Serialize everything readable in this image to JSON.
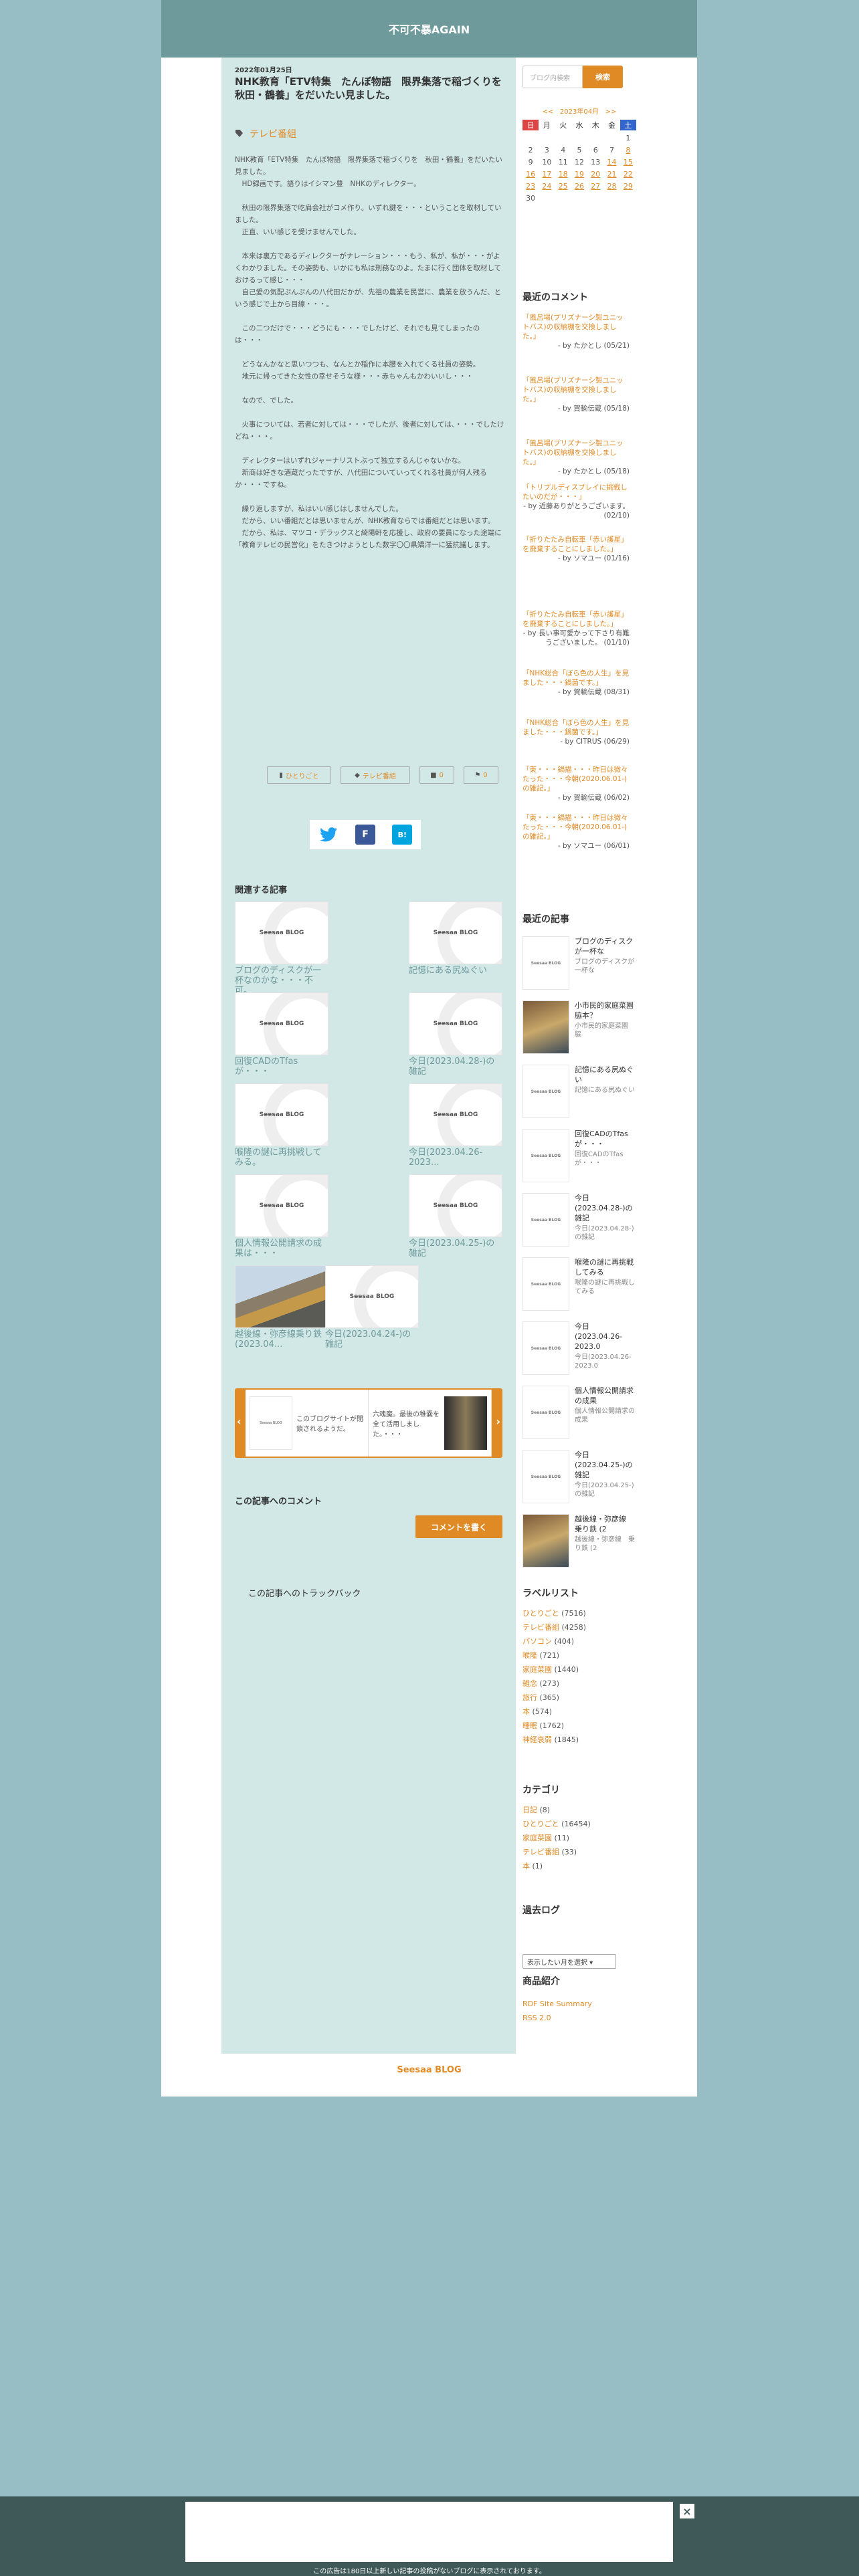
{
  "site": {
    "title": "不可不暴AGAIN",
    "footer": "Seesaa BLOG"
  },
  "post": {
    "date": "2022年01月25日",
    "title": "NHK教育「ETV特集　たんぼ物語　限界集落で稲づくりを　秋田・鶴養」をだいたい見ました。",
    "category": "テレビ番組",
    "body": [
      "NHK教育「ETV特集　たんぼ物語　限界集落で稲づくりを　秋田・鶴養」をだいたい見ました。\n　HD録画です。語りはイシマン豊　NHKのディレクター。",
      "",
      "　秋田の限界集落で吃肩会社がコメ作り。いずれ鍵を・・・ということを取材していました。\n　正直、いい感じを受けませんでした。",
      "",
      "　本来は裏方であるディレクターがナレーション・・・もう、私が、私が・・・がよくわかりました。その姿勢も、いかにも私は刑務なのよ。たまに行く団体を取材しておけるって感じ・・・\n　自己愛の気配ぷんぷんの八代田だかが、先祖の農業を民営に、農業を放うんだ、という感じで上から目線・・・。",
      "",
      "　この二つだけで・・・どうにも・・・でしたけど、それでも見てしまったのは・・・",
      "",
      "　どうなんかなと思いつつも、なんとか稲作に本腰を入れてくる社員の姿勢。\n　地元に帰ってきた女性の幸せそうな様・・・赤ちゃんもかわいいし・・・",
      "",
      "　なので、でした。",
      "",
      "　火事については、若者に対しては・・・でしたが、後者に対しては、・・・でしたけどね・・・。",
      "",
      "　ディレクターはいずれジャーナリストぶって独立するんじゃないかな。\n　新商は好きな酒蔵だったですが、八代田についていってくれる社員が何人残るか・・・ですね。",
      "",
      "　繰り返しますが、私はいい感じはしませんでした。\n　だから、いい番組だとは思いませんが、NHK教育ならでは番組だとは思います。\n　だから、私は、マツコ・デラックスと綺陽軒を応援し、政府の要員になった途端に「教育テレビの民営化」をたきつけようとした数字〇〇県矯洋一に猛抗議します。"
    ],
    "pills": [
      "ひとりごと",
      "テレビ番組",
      "0",
      "0"
    ]
  },
  "share": {
    "twitter": "twitter-icon",
    "facebook": "F",
    "hatena": "B!"
  },
  "related": {
    "heading": "関連する記事",
    "items": [
      {
        "caption": "ブログのディスクが一杯なのかな・・・不可。",
        "thumb": "Seesaa BLOG"
      },
      {
        "caption": "記憶にある尻ぬぐい",
        "thumb": "Seesaa BLOG"
      },
      {
        "caption": "回復CADのTfasが・・・",
        "thumb": "Seesaa BLOG"
      },
      {
        "caption": "今日(2023.04.28-)の雑記",
        "thumb": "Seesaa BLOG"
      },
      {
        "caption": "喉隆の謎に再挑戦してみる。",
        "thumb": "Seesaa BLOG"
      },
      {
        "caption": "今日(2023.04.26-2023...",
        "thumb": "Seesaa BLOG"
      },
      {
        "caption": "個人情報公開請求の成果は・・・",
        "thumb": "Seesaa BLOG"
      },
      {
        "caption": "今日(2023.04.25-)の雑記",
        "thumb": "Seesaa BLOG"
      },
      {
        "caption": "越後線・弥彦線乗り鉄 (2023.04...",
        "thumb": ""
      },
      {
        "caption": "今日(2023.04.24-)の雑記",
        "thumb": "Seesaa BLOG"
      }
    ]
  },
  "slider": {
    "items": [
      {
        "text": "このブログサイトが閉鎖されるようだ。"
      },
      {
        "text": "六魂魔。最後の稚嚢を全て活用しました。・・・"
      }
    ]
  },
  "comments_section": {
    "heading": "この記事へのコメント",
    "write_button": "コメントを書く",
    "trackback": "この記事へのトラックバック"
  },
  "sidebar": {
    "search": {
      "placeholder": "ブログ内検索",
      "button": "検索"
    },
    "calendar": {
      "prev": "<<",
      "month": "2023年04月",
      "next": ">>",
      "dow": [
        "日",
        "月",
        "火",
        "水",
        "木",
        "金",
        "土"
      ],
      "rows": [
        [
          "",
          "",
          "",
          "",
          "",
          "",
          "1"
        ],
        [
          "2",
          "3",
          "4",
          "5",
          "6",
          "7",
          "8"
        ],
        [
          "9",
          "10",
          "11",
          "12",
          "13",
          "14",
          "15"
        ],
        [
          "16",
          "17",
          "18",
          "19",
          "20",
          "21",
          "22"
        ],
        [
          "23",
          "24",
          "25",
          "26",
          "27",
          "28",
          "29"
        ],
        [
          "30",
          "",
          "",
          "",
          "",
          "",
          ""
        ]
      ]
    },
    "recent_comments": {
      "heading": "最近のコメント",
      "items": [
        {
          "title": "「風呂場(プリズナーシ製ユニットバス)の収納棚を交換しました。」",
          "by": "- by たかとし (05/21)"
        },
        {
          "title": "「風呂場(プリズナーシ製ユニットバス)の収納棚を交換しました。」",
          "by": "- by 賀輸伝蔵 (05/18)"
        },
        {
          "title": "「風呂場(プリズナーシ製ユニットバス)の収納棚を交換しました。」",
          "by": "- by たかとし (05/18)"
        },
        {
          "title": "「トリプルディスプレイに挑戦したいのだが・・・」",
          "by": "- by 近藤ありがとうございます。 (02/10)"
        },
        {
          "title": "「折りたたみ自転車「赤い護星」を廃棄することにしました。」",
          "by": "- by ソマユー (01/16)"
        },
        {
          "title": "「折りたたみ自転車「赤い護星」を廃棄することにしました。」",
          "by": "- by 長い事可愛かって下さり有難うございました。 (01/10)"
        },
        {
          "title": "「NHK総合「ぼら色の人生」を見ました・・・鍋菌です。」",
          "by": "- by 賀輸伝蔵 (08/31)"
        },
        {
          "title": "「NHK総合「ぼら色の人生」を見ました・・・鍋菌です。」",
          "by": "- by CITRUS (06/29)"
        },
        {
          "title": "「東・・・鍋描・・・昨日は微々たった・・・今朝(2020.06.01-)の雑記。」",
          "by": "- by 賀輸伝蔵 (06/02)"
        },
        {
          "title": "「東・・・鍋描・・・昨日は微々たった・・・今朝(2020.06.01-)の雑記。」",
          "by": "- by ソマユー (06/01)"
        }
      ]
    },
    "recent_posts": {
      "heading": "最近の記事",
      "items": [
        {
          "title": "ブログのディスクが一杯な",
          "excerpt": "ブログのディスクが一杯な",
          "thumb": "Seesaa BLOG"
        },
        {
          "title": "小市民的家庭菜園　脇本？",
          "excerpt": "小市民的家庭菜園　脇",
          "thumb": ""
        },
        {
          "title": "記憶にある尻ぬぐい",
          "excerpt": "記憶にある尻ぬぐい",
          "thumb": "Seesaa BLOG"
        },
        {
          "title": "回復CADのTfasが・・・",
          "excerpt": "回復CADのTfasが・・・",
          "thumb": "Seesaa BLOG"
        },
        {
          "title": "今日(2023.04.28-)の雑記",
          "excerpt": "今日(2023.04.28-)の雑記",
          "thumb": "Seesaa BLOG"
        },
        {
          "title": "喉隆の謎に再挑戦してみる",
          "excerpt": "喉隆の謎に再挑戦してみる",
          "thumb": "Seesaa BLOG"
        },
        {
          "title": "今日(2023.04.26-　2023.0",
          "excerpt": "今日(2023.04.26-　2023.0",
          "thumb": "Seesaa BLOG"
        },
        {
          "title": "個人情報公開請求の成果",
          "excerpt": "個人情報公開請求の成果",
          "thumb": "Seesaa BLOG"
        },
        {
          "title": "今日(2023.04.25-)の雑記",
          "excerpt": "今日(2023.04.25-)の雑記",
          "thumb": "Seesaa BLOG"
        },
        {
          "title": "越後線・弥彦線　乗り鉄 (2",
          "excerpt": "越後線・弥彦線　乗り鉄 (2",
          "thumb": ""
        }
      ]
    },
    "labels": {
      "heading": "ラベルリスト",
      "items": [
        {
          "name": "ひとりごと",
          "count": "(7516)"
        },
        {
          "name": "テレビ番組",
          "count": "(4258)"
        },
        {
          "name": "パソコン",
          "count": "(404)"
        },
        {
          "name": "喉隆",
          "count": "(721)"
        },
        {
          "name": "家庭菜園",
          "count": "(1440)"
        },
        {
          "name": "雑念",
          "count": "(273)"
        },
        {
          "name": "旅行",
          "count": "(365)"
        },
        {
          "name": "本",
          "count": "(574)"
        },
        {
          "name": "睡眠",
          "count": "(1762)"
        },
        {
          "name": "神経衰弱",
          "count": "(1845)"
        }
      ]
    },
    "categories": {
      "heading": "カテゴリ",
      "items": [
        {
          "name": "日記",
          "count": "(8)"
        },
        {
          "name": "ひとりごと",
          "count": "(16454)"
        },
        {
          "name": "家庭菜園",
          "count": "(11)"
        },
        {
          "name": "テレビ番組",
          "count": "(33)"
        },
        {
          "name": "本",
          "count": "(1)"
        }
      ]
    },
    "archive": {
      "heading": "過去ログ",
      "select": "表示したい月を選択 ▾"
    },
    "products": {
      "heading": "商品紹介"
    },
    "feeds": [
      "RDF Site Summary",
      "RSS 2.0"
    ]
  },
  "ad": {
    "close": "×",
    "note": "この広告は180日以上新しい記事の投稿がないブログに表示されております。"
  }
}
